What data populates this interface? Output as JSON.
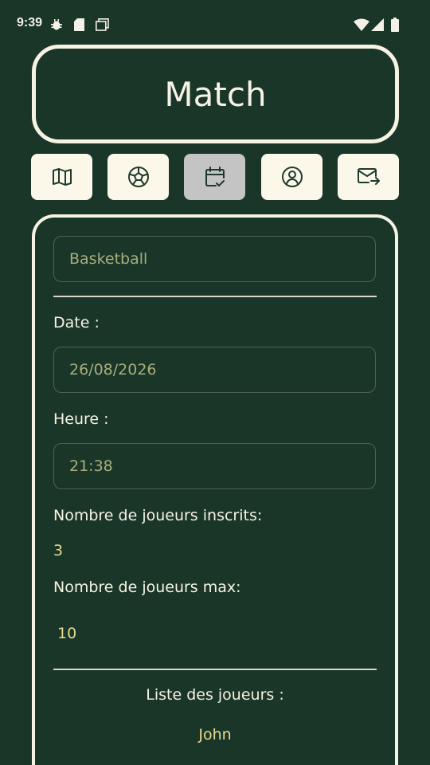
{
  "status_bar": {
    "time": "9:39",
    "icons": [
      "bug-icon",
      "sd-card-icon",
      "screen-icon",
      "wifi-icon",
      "signal-icon",
      "battery-icon"
    ]
  },
  "header": {
    "title": "Match"
  },
  "nav": {
    "items": [
      {
        "icon": "map-icon",
        "active": false
      },
      {
        "icon": "soccer-ball-icon",
        "active": false
      },
      {
        "icon": "calendar-check-icon",
        "active": true
      },
      {
        "icon": "user-circle-icon",
        "active": false
      },
      {
        "icon": "mail-forward-icon",
        "active": false
      }
    ],
    "active_color": "#c4c4c4",
    "button_color": "#fbf8ea"
  },
  "match": {
    "sport": "Basketball",
    "date_label": "Date :",
    "date_value": "26/08/2026",
    "time_label": "Heure :",
    "time_value": "21:38",
    "registered_label": "Nombre de joueurs inscrits:",
    "registered_value": "3",
    "max_label": "Nombre de joueurs max:",
    "max_value": "10",
    "players_label": "Liste des joueurs :",
    "players": [
      "John"
    ]
  },
  "colors": {
    "background": "#193629",
    "foreground": "#f7f3e4",
    "field_text": "#a8ae7c",
    "value_text": "#e9d98e"
  }
}
